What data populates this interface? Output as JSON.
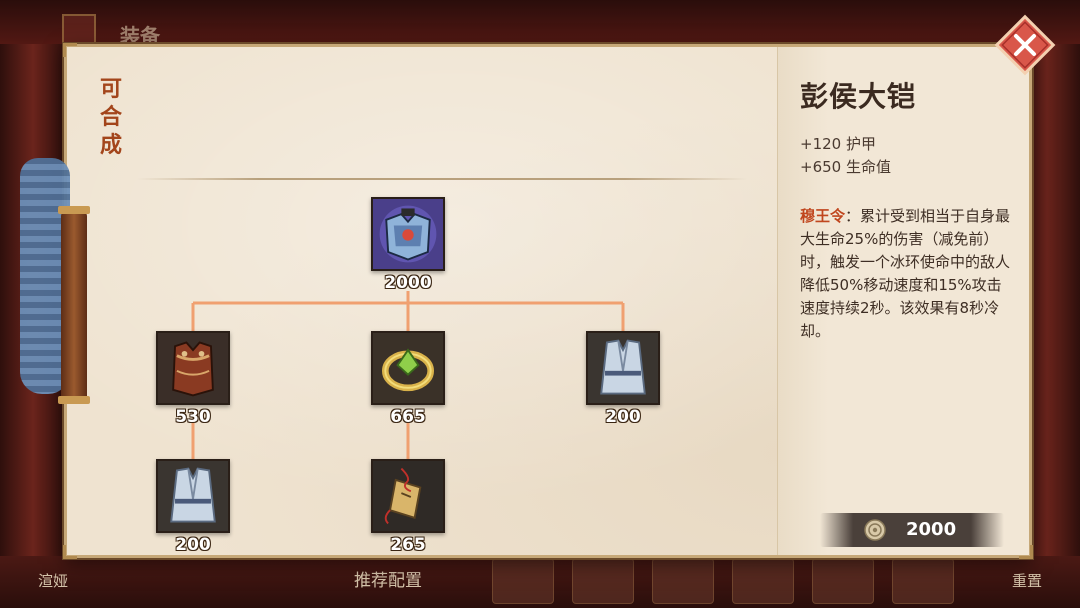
{
  "background": {
    "header_title": "装备",
    "bottom_left_label": "渲娅",
    "recommend_label": "推荐配置",
    "reset_label": "重置"
  },
  "panel": {
    "craft_title": "可合成",
    "tree": {
      "root": {
        "price": "2000",
        "icon": "blue-armor-icon"
      },
      "tier2": [
        {
          "price": "530",
          "icon": "leather-vest-icon"
        },
        {
          "price": "665",
          "icon": "gold-ring-icon"
        },
        {
          "price": "200",
          "icon": "white-robe-icon"
        }
      ],
      "tier3": [
        {
          "price": "200",
          "icon": "white-robe-icon"
        },
        {
          "price": "265",
          "icon": "token-icon"
        }
      ]
    }
  },
  "item_detail": {
    "name": "彭侯大铠",
    "stats": [
      "+120 护甲",
      "+650 生命值"
    ],
    "skill_name": "穆王令",
    "skill_desc": "：累计受到相当于自身最大生命25%的伤害（减免前）时，触发一个冰环使命中的敌人降低50%移动速度和15%攻击速度持续2秒。该效果有8秒冷却。",
    "cost": "2000"
  },
  "colors": {
    "connector": "#f0a070",
    "skill_accent": "#c0461e",
    "close_button": "#d9574a"
  }
}
